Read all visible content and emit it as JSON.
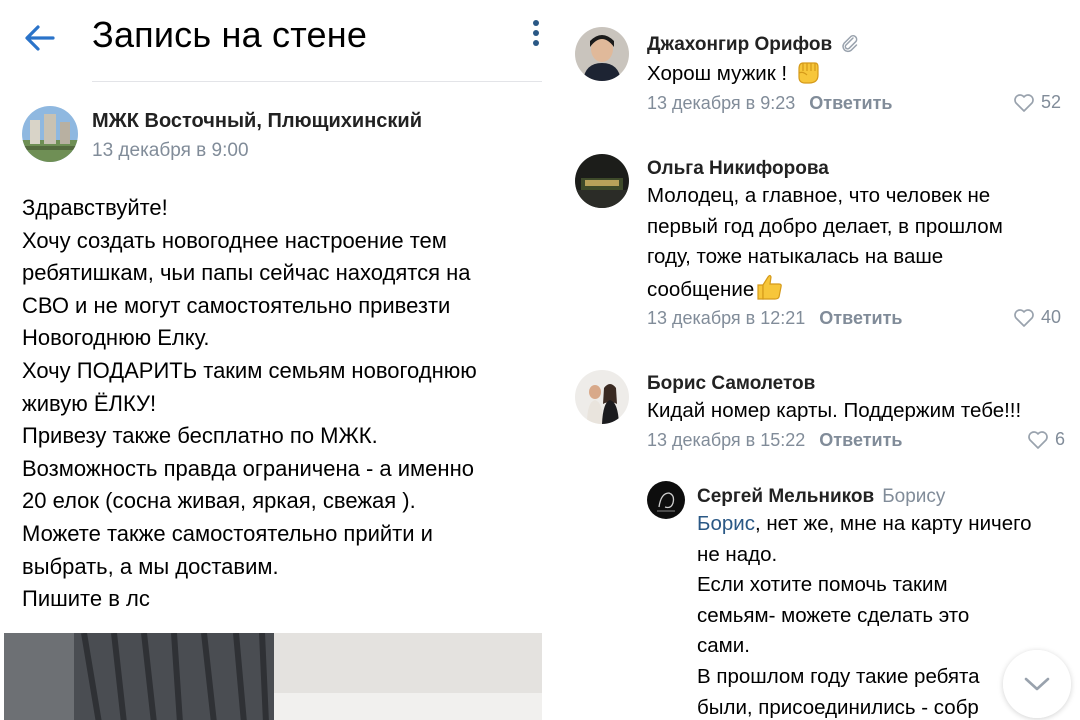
{
  "header": {
    "title": "Запись на стене",
    "back_icon": "arrow-left-icon",
    "more_icon": "more-vertical-icon"
  },
  "post": {
    "author": "МЖК Восточный, Плющихинский",
    "date": "13 декабря в 9:00",
    "lines": [
      "Здравствуйте!",
      "Хочу создать новогоднее настроение тем",
      "ребятишкам, чьи папы сейчас находятся на",
      "СВО и не могут самостоятельно привезти",
      "Новогоднюю Елку.",
      "Хочу ПОДАРИТЬ таким семьям новогоднюю",
      "живую ЁЛКУ!",
      "Привезу также бесплатно по МЖК.",
      "Возможность правда ограничена - а именно",
      "20 елок (сосна живая, яркая, свежая ).",
      "Можете также самостоятельно прийти и",
      "выбрать, а мы доставим.",
      "Пишите в лс"
    ]
  },
  "comments": [
    {
      "name": "Джахонгир Орифов",
      "name_icon": "paperclip-icon",
      "text": "Хорош мужик !",
      "emoji": "raised-fist-emoji",
      "date": "13 декабря в 9:23",
      "reply_label": "Ответить",
      "likes": "52"
    },
    {
      "name": "Ольга Никифорова",
      "lines": [
        "Молодец, а главное, что человек не",
        "первый год добро делает, в прошлом",
        "году, тоже натыкалась на ваше",
        "сообщение"
      ],
      "emoji": "thumbs-up-emoji",
      "date": "13 декабря в 12:21",
      "reply_label": "Ответить",
      "likes": "40"
    },
    {
      "name": "Борис Самолетов",
      "text": "Кидай номер карты. Поддержим тебе!!!",
      "date": "13 декабря в 15:22",
      "reply_label": "Ответить",
      "likes": "6"
    },
    {
      "name": "Сергей Мельников",
      "reply_to": "Борису",
      "mention": "Борис",
      "first_line_rest": ", нет же, мне на карту ничего",
      "lines": [
        "не надо.",
        "Если хотите помочь таким",
        "семьям- можете сделать это",
        "сами.",
        "В прошлом году такие ребята",
        "были, присоединились - собр"
      ]
    }
  ],
  "scroll_down_icon": "chevron-down-icon",
  "colors": {
    "accent": "#2a5885",
    "meta": "#818c99",
    "like_heart": "#818c99"
  }
}
